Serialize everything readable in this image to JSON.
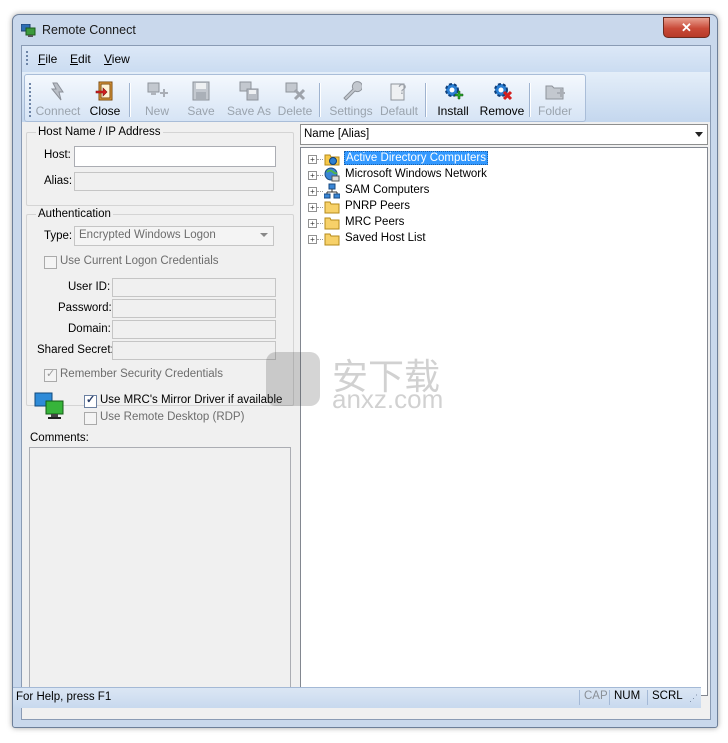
{
  "window": {
    "title": "Remote Connect",
    "close_glyph": "✕"
  },
  "menu": [
    {
      "label": "File",
      "key": "F",
      "rest": "ile"
    },
    {
      "label": "Edit",
      "key": "E",
      "rest": "dit"
    },
    {
      "label": "View",
      "key": "V",
      "rest": "iew"
    }
  ],
  "toolbar": {
    "connect": "Connect",
    "close": "Close",
    "new": "New",
    "save": "Save",
    "save_as": "Save As",
    "delete": "Delete",
    "settings": "Settings",
    "default": "Default",
    "install": "Install",
    "remove": "Remove",
    "folder": "Folder"
  },
  "host_group": {
    "title": "Host Name / IP Address",
    "host_label": "Host:",
    "host_value": "",
    "alias_label": "Alias:",
    "alias_value": ""
  },
  "auth_group": {
    "title": "Authentication",
    "type_label": "Type:",
    "type_value": "Encrypted Windows Logon",
    "use_current_label": "Use Current Logon Credentials",
    "userid_label": "User ID:",
    "password_label": "Password:",
    "domain_label": "Domain:",
    "secret_label": "Shared Secret:",
    "remember_label": "Remember Security Credentials"
  },
  "options": {
    "mirror_driver_label": "Use MRC's Mirror Driver if available",
    "rdp_label": "Use Remote Desktop (RDP)"
  },
  "comments_label": "Comments:",
  "tree": {
    "header": "Name [Alias]",
    "items": [
      {
        "label": "Active Directory Computers",
        "icon": "active-directory-icon",
        "selected": true
      },
      {
        "label": "Microsoft Windows Network",
        "icon": "network-globe-icon"
      },
      {
        "label": "SAM Computers",
        "icon": "sam-computers-icon"
      },
      {
        "label": "PNRP Peers",
        "icon": "folder-icon"
      },
      {
        "label": "MRC Peers",
        "icon": "folder-icon"
      },
      {
        "label": "Saved Host List",
        "icon": "folder-icon"
      }
    ]
  },
  "statusbar": {
    "help": "For Help, press F1",
    "cap": "CAP",
    "num": "NUM",
    "scrl": "SCRL"
  },
  "watermark": {
    "cn": "安下载",
    "en": "anxz.com"
  },
  "colors": {
    "selection": "#3399ff",
    "frame": "#c9d8ec",
    "disabled_text": "#9aa3ad"
  }
}
